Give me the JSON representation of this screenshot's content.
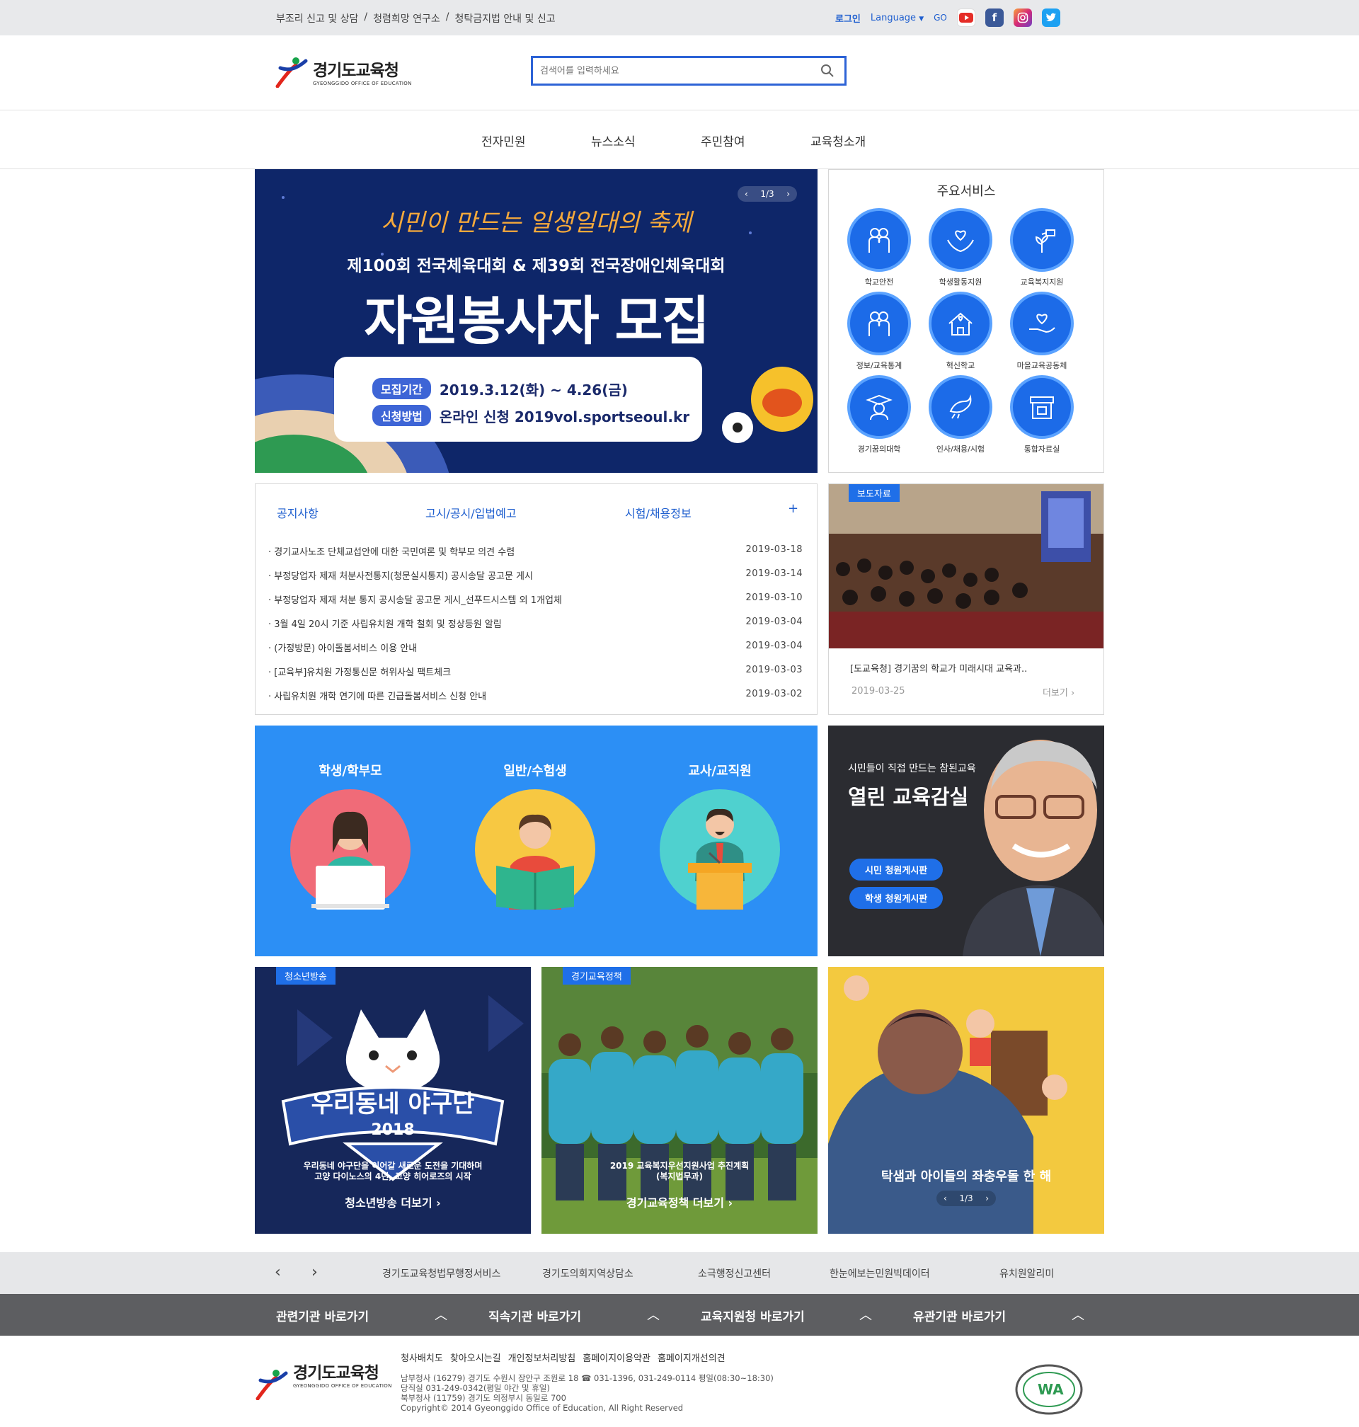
{
  "topbar": {
    "links": [
      "부조리 신고 및 상담",
      "청렴희망 연구소",
      "청탁금지법 안내 및 신고"
    ],
    "separator": "/",
    "login": "로그인",
    "language": "Language",
    "go": "GO"
  },
  "header": {
    "logo_main": "경기도교육청",
    "logo_sub": "GYEONGGIDO OFFICE OF EDUCATION",
    "search_placeholder": "검색어를 입력하세요"
  },
  "gnb": [
    "전자민원",
    "뉴스소식",
    "주민참여",
    "교육청소개"
  ],
  "banner": {
    "pager": "1/3",
    "line1": "시민이 만드는 일생일대의 축제",
    "line2": "제100회 전국체육대회 & 제39회 전국장애인체육대회",
    "headline": "자원봉사자 모집",
    "period_label": "모집기간",
    "period_value": "2019.3.12(화) ~ 4.26(금)",
    "method_label": "신청방법",
    "method_value": "온라인 신청 2019vol.sportseoul.kr"
  },
  "services": {
    "title": "주요서비스",
    "items": [
      {
        "label": "학교안전",
        "icon": "family-icon"
      },
      {
        "label": "학생활동지원",
        "icon": "heart-hands-icon"
      },
      {
        "label": "교육복지지원",
        "icon": "watering-plant-icon"
      },
      {
        "label": "정보/교육통계",
        "icon": "people-icon"
      },
      {
        "label": "혁신학교",
        "icon": "house-heart-icon"
      },
      {
        "label": "마을교육공동체",
        "icon": "hand-heart-icon"
      },
      {
        "label": "경기꿈의대학",
        "icon": "graduate-icon"
      },
      {
        "label": "인사/채용/시험",
        "icon": "dove-icon"
      },
      {
        "label": "통합자료실",
        "icon": "archive-box-icon"
      }
    ]
  },
  "notices": {
    "tabs": [
      "공지사항",
      "고시/공시/입법예고",
      "시험/채용정보"
    ],
    "more": "+",
    "rows": [
      {
        "title": "경기교사노조 단체교섭안에 대한 국민여론 및 학부모 의견 수렴",
        "date": "2019-03-18"
      },
      {
        "title": "부정당업자 제재 처분사전통지(청문실시통지) 공시송달 공고문 게시",
        "date": "2019-03-14"
      },
      {
        "title": "부정당업자 제재 처분 통지 공시송달 공고문 게시_선푸드시스템 외 1개업체",
        "date": "2019-03-10"
      },
      {
        "title": "3월 4일 20시 기준 사립유치원 개학 철회 및 정상등원 알림",
        "date": "2019-03-04"
      },
      {
        "title": "(가정방문) 아이돌봄서비스 이용 안내",
        "date": "2019-03-04"
      },
      {
        "title": "[교육부]유치원 가정통신문 허위사실 팩트체크",
        "date": "2019-03-03"
      },
      {
        "title": "사립유치원 개학 연기에 따른 긴급돌봄서비스 신청 안내",
        "date": "2019-03-02"
      }
    ]
  },
  "press": {
    "badge": "보도자료",
    "title": "[도교육청] 경기꿈의 학교가 미래시대 교육과..",
    "date": "2019-03-25",
    "more": "더보기"
  },
  "audience": [
    {
      "label": "학생/학부모",
      "color": "#f06b78",
      "icon": "student-laptop-icon"
    },
    {
      "label": "일반/수험생",
      "color": "#f7c842",
      "icon": "reader-book-icon"
    },
    {
      "label": "교사/교직원",
      "color": "#4fd1cf",
      "icon": "teacher-podium-icon"
    }
  ],
  "open_class": {
    "subtitle": "시민들이 직접 만드는 참된교육",
    "title": "열린 교육감실",
    "btn1": "시민 청원게시판",
    "btn2": "학생 청원게시판"
  },
  "tiles": [
    {
      "badge": "청소년방송",
      "art_text": "우리동네 야구단",
      "art_year": "2018",
      "caption": "우리동네 야구단을 이어갈 새로운 도전을 기대하며\n고양 다이노스의 4년, 고양 히어로즈의 시작",
      "more": "청소년방송 더보기"
    },
    {
      "badge": "경기교육정책",
      "caption": "2019 교육복지우선지원사업 추진계획\n(복지법무과)",
      "more": "경기교육정책 더보기"
    },
    {
      "caption": "탁샘과 아이들의 좌충우돌 한 해",
      "pager": "1/3"
    }
  ],
  "quick_links": [
    "경기도교육청법무행정서비스",
    "경기도의회지역상담소",
    "소극행정신고센터",
    "한눈에보는민원빅데이터",
    "유치원알리미"
  ],
  "shortcuts": [
    "관련기관 바로가기",
    "직속기관 바로가기",
    "교육지원청 바로가기",
    "유관기관 바로가기"
  ],
  "footer": {
    "links": [
      "청사배치도",
      "찾아오시는길",
      "개인정보처리방침",
      "홈페이지이용약관",
      "홈페이지개선의견"
    ],
    "addr1": "남부청사 (16279) 경기도 수원시 장안구 조원로 18 ☎ 031-1396, 031-249-0114 평일(08:30~18:30)",
    "addr2": "당직실 031-249-0342(평일 야간 및 휴일)",
    "addr3": "북부청사 (11759) 경기도 의정부시 동일로 700",
    "copyright": "Copyright© 2014 Gyeonggido Office of Education, All Right Reserved",
    "wa_mark": "WA"
  },
  "colors": {
    "accent": "#1f6fe8",
    "banner_bg": "#0e2669",
    "audience_bg": "#2c8ff5",
    "shortcut_bg": "#5d5e61"
  }
}
